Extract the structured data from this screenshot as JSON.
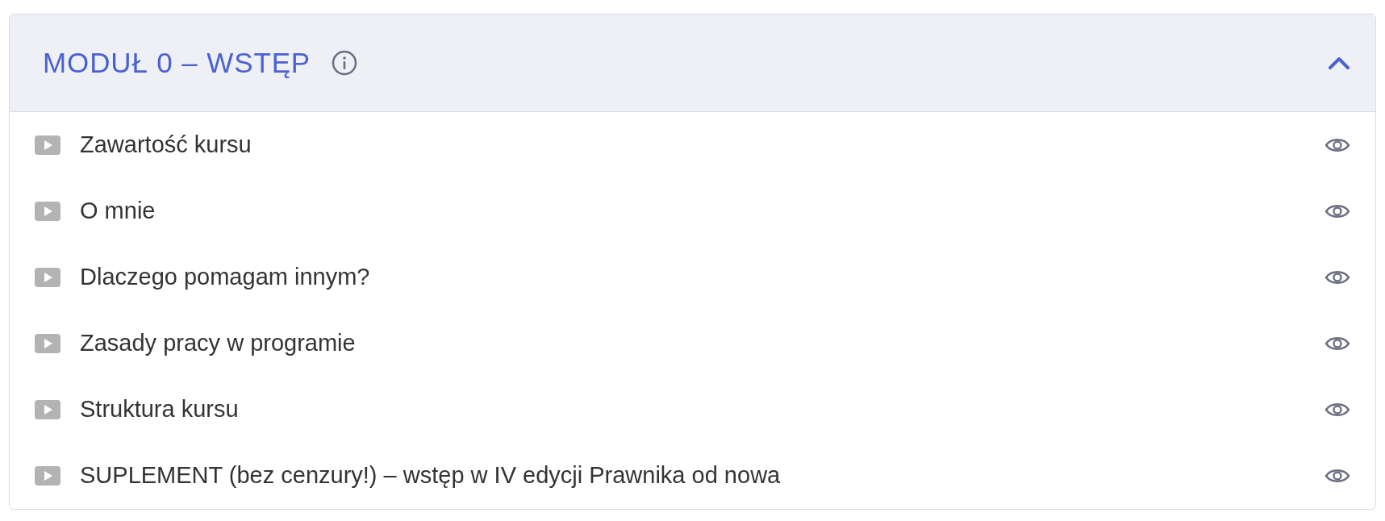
{
  "module": {
    "title": "MODUŁ 0 – WSTĘP",
    "expanded": true
  },
  "lessons": [
    {
      "kind": "video",
      "title": "Zawartość kursu"
    },
    {
      "kind": "video",
      "title": "O mnie"
    },
    {
      "kind": "video",
      "title": "Dlaczego pomagam innym?"
    },
    {
      "kind": "video",
      "title": "Zasady pracy w programie"
    },
    {
      "kind": "video",
      "title": "Struktura kursu"
    },
    {
      "kind": "video",
      "title": "SUPLEMENT (bez cenzury!) – wstęp w IV edycji Prawnika od nowa"
    }
  ]
}
